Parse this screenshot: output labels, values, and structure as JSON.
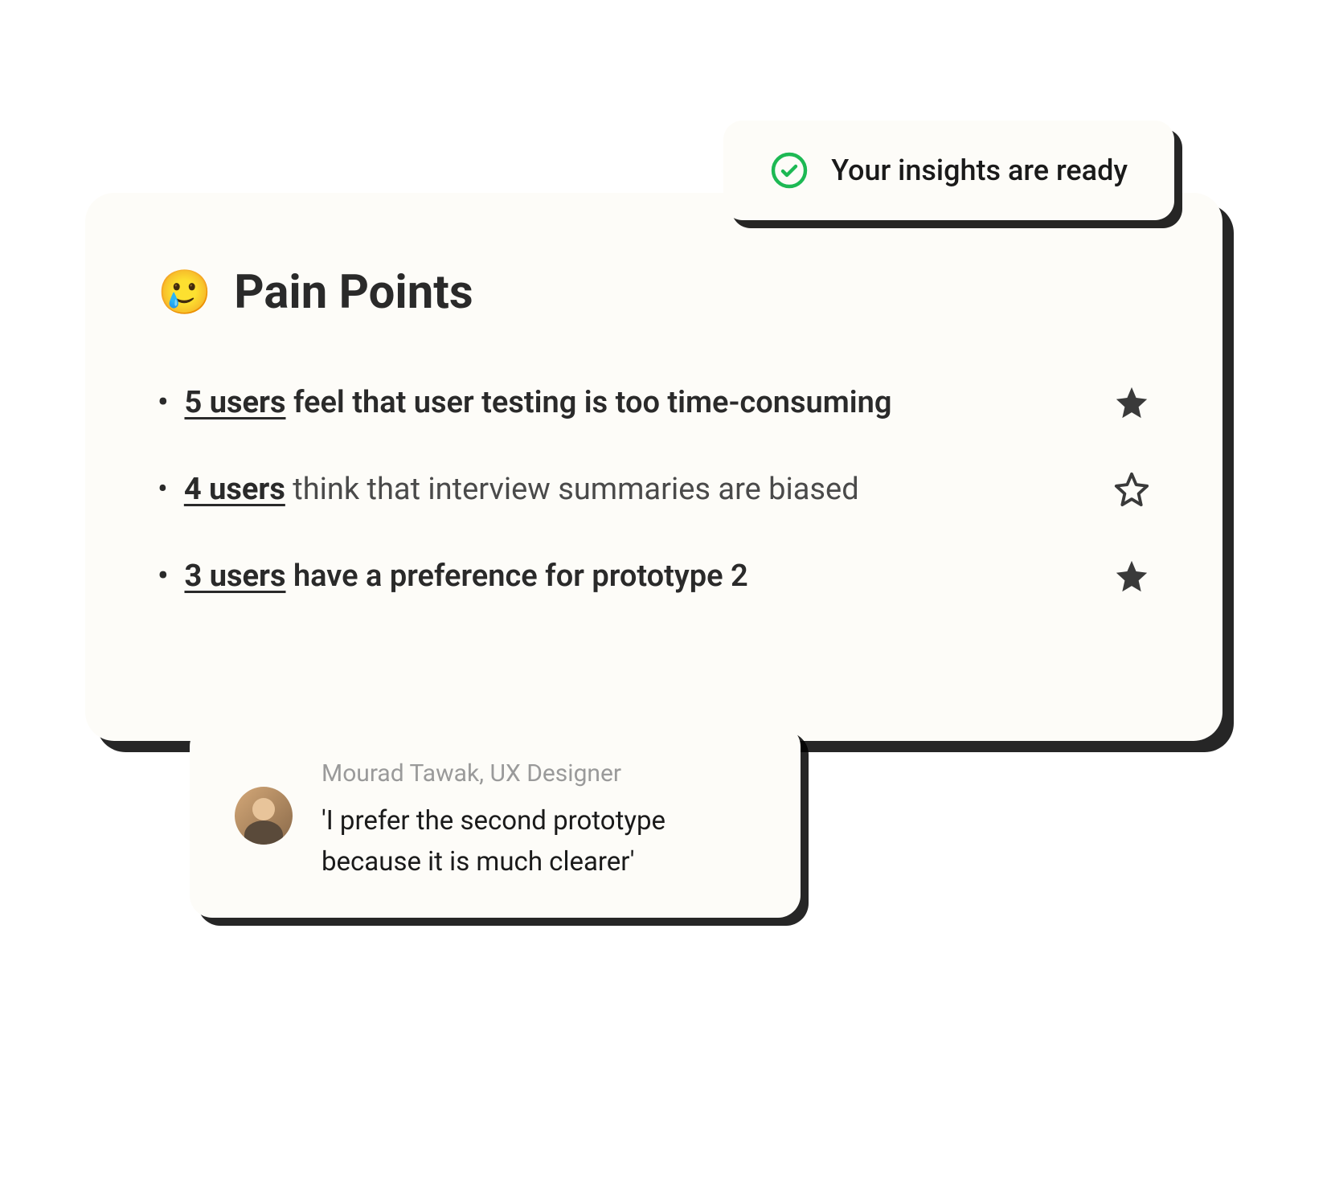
{
  "toast": {
    "message": "Your insights are ready"
  },
  "card": {
    "emoji": "🥲",
    "title": "Pain Points",
    "insights": [
      {
        "user_count": "5 users",
        "rest": " feel that user testing is too time-consuming",
        "starred": true,
        "bold": true
      },
      {
        "user_count": "4 users",
        "rest": " think that interview summaries are biased",
        "starred": false,
        "bold": false
      },
      {
        "user_count": "3 users",
        "rest": " have a preference for prototype 2",
        "starred": true,
        "bold": true
      }
    ]
  },
  "quote": {
    "author": "Mourad Tawak, UX Designer",
    "text": "'I prefer the second prototype because it is much clearer'"
  }
}
